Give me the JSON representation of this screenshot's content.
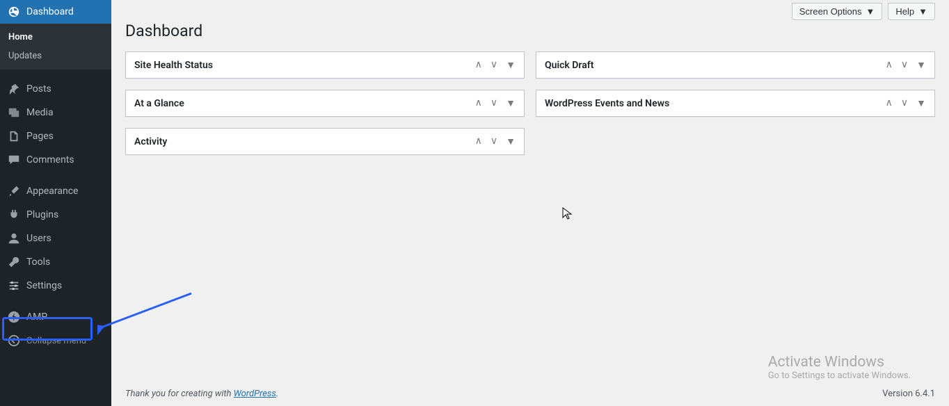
{
  "sidebar": {
    "dashboard": "Dashboard",
    "sub": {
      "home": "Home",
      "updates": "Updates"
    },
    "posts": "Posts",
    "media": "Media",
    "pages": "Pages",
    "comments": "Comments",
    "appearance": "Appearance",
    "plugins": "Plugins",
    "users": "Users",
    "tools": "Tools",
    "settings": "Settings",
    "amp": "AMP",
    "collapse": "Collapse menu"
  },
  "topbar": {
    "screen_options": "Screen Options",
    "help": "Help"
  },
  "page_title": "Dashboard",
  "boxes": {
    "site_health": "Site Health Status",
    "at_a_glance": "At a Glance",
    "activity": "Activity",
    "quick_draft": "Quick Draft",
    "events_news": "WordPress Events and News"
  },
  "footer": {
    "prefix": "Thank you for creating with ",
    "link": "WordPress",
    "suffix": "."
  },
  "version": "Version 6.4.1",
  "watermark": {
    "title": "Activate Windows",
    "subtitle": "Go to Settings to activate Windows."
  }
}
